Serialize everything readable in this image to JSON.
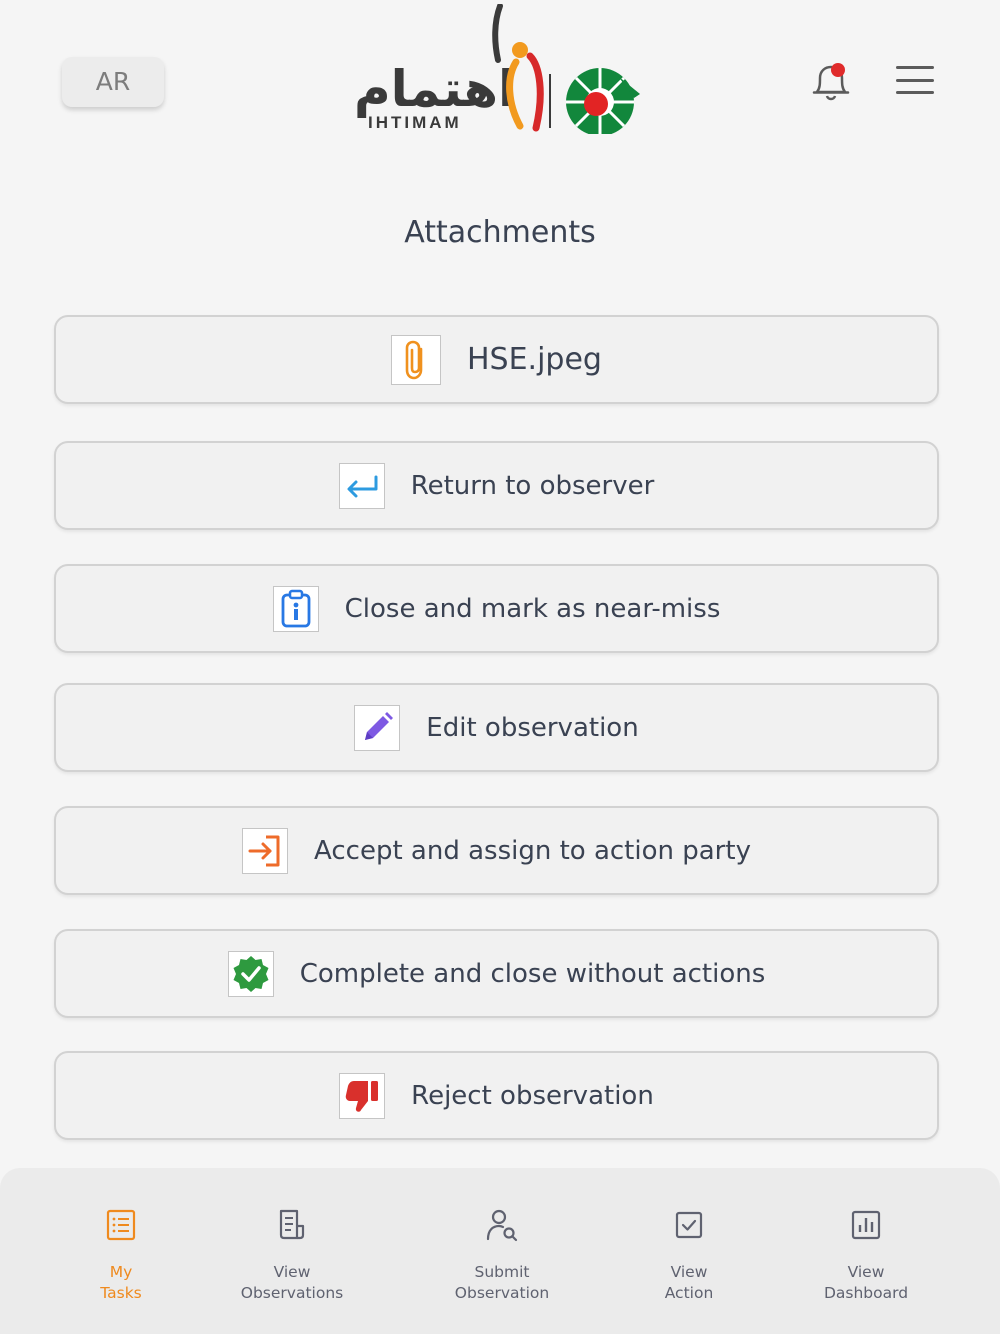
{
  "header": {
    "lang_button": "AR",
    "logo_text": "IHTIMAM",
    "logo_arabic": "اهتمام"
  },
  "page": {
    "title": "Attachments"
  },
  "actions": [
    {
      "label": "HSE.jpeg",
      "icon": "paperclip-icon",
      "color": "#f0911e"
    },
    {
      "label": "Return to observer",
      "icon": "return-arrow-icon",
      "color": "#2d9be0"
    },
    {
      "label": "Close and mark as near-miss",
      "icon": "info-clipboard-icon",
      "color": "#2878e4"
    },
    {
      "label": "Edit observation",
      "icon": "pencil-icon",
      "color": "#7e59e3"
    },
    {
      "label": "Accept and assign to action party",
      "icon": "sign-in-arrow-icon",
      "color": "#ee6b2a"
    },
    {
      "label": "Complete and close without actions",
      "icon": "verified-badge-icon",
      "color": "#2e9a3f"
    },
    {
      "label": "Reject observation",
      "icon": "thumbs-down-icon",
      "color": "#d9302c"
    }
  ],
  "bottom_nav": [
    {
      "line1": "My",
      "line2": "Tasks",
      "icon": "task-list-icon",
      "active": true
    },
    {
      "line1": "View",
      "line2": "Observations",
      "icon": "document-list-icon",
      "active": false
    },
    {
      "line1": "Submit",
      "line2": "Observation",
      "icon": "user-search-icon",
      "active": false
    },
    {
      "line1": "View",
      "line2": "Action",
      "icon": "checkbox-icon",
      "active": false
    },
    {
      "line1": "View",
      "line2": "Dashboard",
      "icon": "bar-chart-icon",
      "active": false
    }
  ],
  "colors": {
    "accent": "#ef8a1e",
    "notification_dot": "#e02b2b"
  }
}
